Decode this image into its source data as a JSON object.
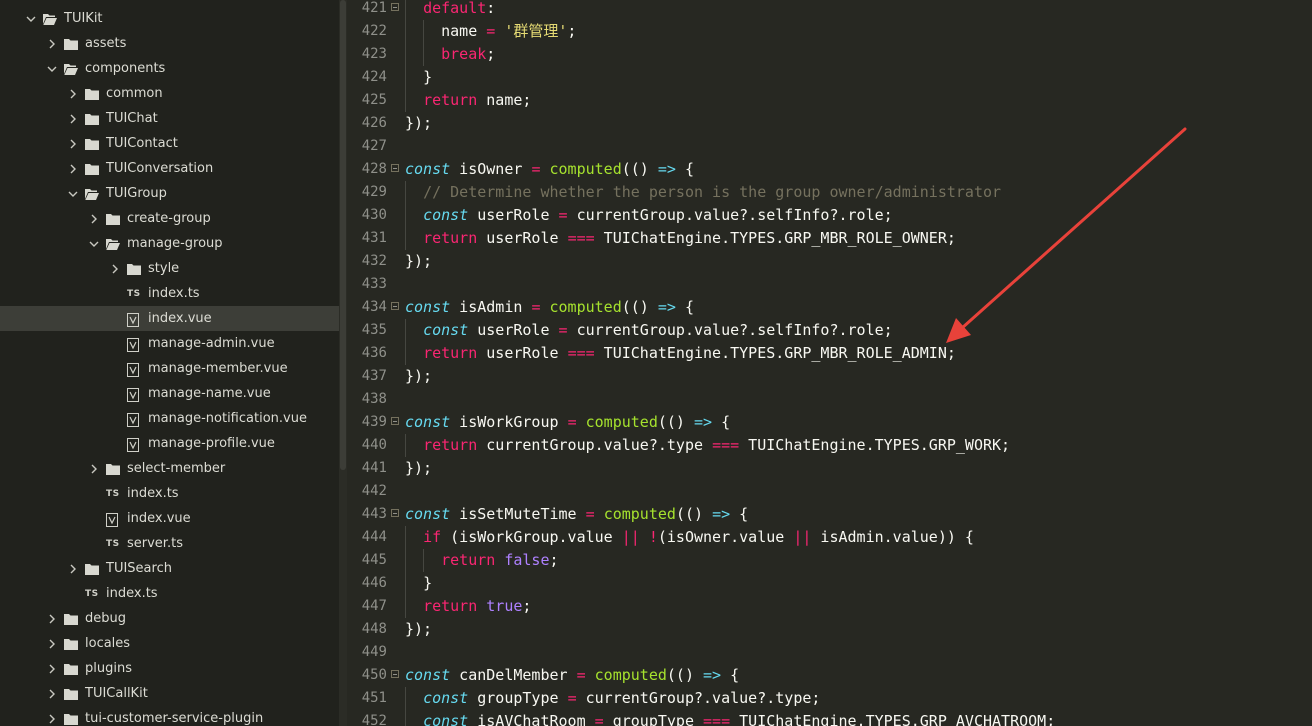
{
  "sidebar": {
    "items": [
      {
        "label": "TUIKit",
        "type": "folder",
        "depth": 0,
        "expanded": true
      },
      {
        "label": "assets",
        "type": "folder",
        "depth": 1,
        "expanded": false
      },
      {
        "label": "components",
        "type": "folder",
        "depth": 1,
        "expanded": true
      },
      {
        "label": "common",
        "type": "folder",
        "depth": 2,
        "expanded": false
      },
      {
        "label": "TUIChat",
        "type": "folder",
        "depth": 2,
        "expanded": false
      },
      {
        "label": "TUIContact",
        "type": "folder",
        "depth": 2,
        "expanded": false
      },
      {
        "label": "TUIConversation",
        "type": "folder",
        "depth": 2,
        "expanded": false
      },
      {
        "label": "TUIGroup",
        "type": "folder",
        "depth": 2,
        "expanded": true
      },
      {
        "label": "create-group",
        "type": "folder",
        "depth": 3,
        "expanded": false
      },
      {
        "label": "manage-group",
        "type": "folder",
        "depth": 3,
        "expanded": true
      },
      {
        "label": "style",
        "type": "folder",
        "depth": 4,
        "expanded": false
      },
      {
        "label": "index.ts",
        "type": "ts",
        "depth": 4,
        "icon_text": "TS"
      },
      {
        "label": "index.vue",
        "type": "vue",
        "depth": 4,
        "selected": true
      },
      {
        "label": "manage-admin.vue",
        "type": "vue",
        "depth": 4
      },
      {
        "label": "manage-member.vue",
        "type": "vue",
        "depth": 4
      },
      {
        "label": "manage-name.vue",
        "type": "vue",
        "depth": 4
      },
      {
        "label": "manage-notification.vue",
        "type": "vue",
        "depth": 4
      },
      {
        "label": "manage-profile.vue",
        "type": "vue",
        "depth": 4
      },
      {
        "label": "select-member",
        "type": "folder",
        "depth": 3,
        "expanded": false
      },
      {
        "label": "index.ts",
        "type": "ts",
        "depth": 3,
        "icon_text": "TS"
      },
      {
        "label": "index.vue",
        "type": "vue",
        "depth": 3
      },
      {
        "label": "server.ts",
        "type": "ts",
        "depth": 3,
        "icon_text": "TS"
      },
      {
        "label": "TUISearch",
        "type": "folder",
        "depth": 2,
        "expanded": false
      },
      {
        "label": "index.ts",
        "type": "ts",
        "depth": 2,
        "icon_text": "TS"
      },
      {
        "label": "debug",
        "type": "folder",
        "depth": 1,
        "expanded": false
      },
      {
        "label": "locales",
        "type": "folder",
        "depth": 1,
        "expanded": false
      },
      {
        "label": "plugins",
        "type": "folder",
        "depth": 1,
        "expanded": false
      },
      {
        "label": "TUICallKit",
        "type": "folder",
        "depth": 1,
        "expanded": false
      },
      {
        "label": "tui-customer-service-plugin",
        "type": "folder",
        "depth": 1,
        "expanded": false
      }
    ]
  },
  "editor": {
    "lines": [
      {
        "n": "421",
        "fold": true,
        "indent": 1,
        "tokens": [
          [
            "kw",
            "default"
          ],
          [
            "p",
            ":"
          ]
        ]
      },
      {
        "n": "422",
        "indent": 2,
        "tokens": [
          [
            "p",
            "name "
          ],
          [
            "op",
            "="
          ],
          [
            "p",
            " "
          ],
          [
            "str",
            "'群管理'"
          ],
          [
            "p",
            ";"
          ]
        ]
      },
      {
        "n": "423",
        "indent": 2,
        "tokens": [
          [
            "kw",
            "break"
          ],
          [
            "p",
            ";"
          ]
        ]
      },
      {
        "n": "424",
        "indent": 1,
        "tokens": [
          [
            "p",
            "}"
          ]
        ]
      },
      {
        "n": "425",
        "indent": 1,
        "tokens": [
          [
            "kw",
            "return"
          ],
          [
            "p",
            " name;"
          ]
        ]
      },
      {
        "n": "426",
        "indent": 0,
        "tokens": [
          [
            "p",
            "});"
          ]
        ]
      },
      {
        "n": "427",
        "indent": 0,
        "tokens": []
      },
      {
        "n": "428",
        "fold": true,
        "indent": 0,
        "tokens": [
          [
            "k",
            "const"
          ],
          [
            "p",
            " isOwner "
          ],
          [
            "op",
            "="
          ],
          [
            "p",
            " "
          ],
          [
            "fn",
            "computed"
          ],
          [
            "p",
            "(() "
          ],
          [
            "k",
            "=>"
          ],
          [
            "p",
            " {"
          ]
        ]
      },
      {
        "n": "429",
        "indent": 1,
        "tokens": [
          [
            "cm",
            "// Determine whether the person is the group owner/administrator"
          ]
        ]
      },
      {
        "n": "430",
        "indent": 1,
        "tokens": [
          [
            "k",
            "const"
          ],
          [
            "p",
            " userRole "
          ],
          [
            "op",
            "="
          ],
          [
            "p",
            " currentGroup.value?.selfInfo?.role;"
          ]
        ]
      },
      {
        "n": "431",
        "indent": 1,
        "tokens": [
          [
            "kw",
            "return"
          ],
          [
            "p",
            " userRole "
          ],
          [
            "op",
            "==="
          ],
          [
            "p",
            " TUIChatEngine.TYPES.GRP_MBR_ROLE_OWNER;"
          ]
        ]
      },
      {
        "n": "432",
        "indent": 0,
        "tokens": [
          [
            "p",
            "});"
          ]
        ]
      },
      {
        "n": "433",
        "indent": 0,
        "tokens": []
      },
      {
        "n": "434",
        "fold": true,
        "indent": 0,
        "tokens": [
          [
            "k",
            "const"
          ],
          [
            "p",
            " isAdmin "
          ],
          [
            "op",
            "="
          ],
          [
            "p",
            " "
          ],
          [
            "fn",
            "computed"
          ],
          [
            "p",
            "(() "
          ],
          [
            "k",
            "=>"
          ],
          [
            "p",
            " {"
          ]
        ]
      },
      {
        "n": "435",
        "indent": 1,
        "tokens": [
          [
            "k",
            "const"
          ],
          [
            "p",
            " userRole "
          ],
          [
            "op",
            "="
          ],
          [
            "p",
            " currentGroup.value?.selfInfo?.role;"
          ]
        ]
      },
      {
        "n": "436",
        "indent": 1,
        "tokens": [
          [
            "kw",
            "return"
          ],
          [
            "p",
            " userRole "
          ],
          [
            "op",
            "==="
          ],
          [
            "p",
            " TUIChatEngine.TYPES.GRP_MBR_ROLE_ADMIN;"
          ]
        ]
      },
      {
        "n": "437",
        "indent": 0,
        "tokens": [
          [
            "p",
            "});"
          ]
        ]
      },
      {
        "n": "438",
        "indent": 0,
        "tokens": []
      },
      {
        "n": "439",
        "fold": true,
        "indent": 0,
        "tokens": [
          [
            "k",
            "const"
          ],
          [
            "p",
            " isWorkGroup "
          ],
          [
            "op",
            "="
          ],
          [
            "p",
            " "
          ],
          [
            "fn",
            "computed"
          ],
          [
            "p",
            "(() "
          ],
          [
            "k",
            "=>"
          ],
          [
            "p",
            " {"
          ]
        ]
      },
      {
        "n": "440",
        "indent": 1,
        "tokens": [
          [
            "kw",
            "return"
          ],
          [
            "p",
            " currentGroup.value?.type "
          ],
          [
            "op",
            "==="
          ],
          [
            "p",
            " TUIChatEngine.TYPES.GRP_WORK;"
          ]
        ]
      },
      {
        "n": "441",
        "indent": 0,
        "tokens": [
          [
            "p",
            "});"
          ]
        ]
      },
      {
        "n": "442",
        "indent": 0,
        "tokens": []
      },
      {
        "n": "443",
        "fold": true,
        "indent": 0,
        "tokens": [
          [
            "k",
            "const"
          ],
          [
            "p",
            " isSetMuteTime "
          ],
          [
            "op",
            "="
          ],
          [
            "p",
            " "
          ],
          [
            "fn",
            "computed"
          ],
          [
            "p",
            "(() "
          ],
          [
            "k",
            "=>"
          ],
          [
            "p",
            " {"
          ]
        ]
      },
      {
        "n": "444",
        "indent": 1,
        "tokens": [
          [
            "kw",
            "if"
          ],
          [
            "p",
            " (isWorkGroup.value "
          ],
          [
            "op",
            "||"
          ],
          [
            "p",
            " "
          ],
          [
            "op",
            "!"
          ],
          [
            "p",
            "(isOwner.value "
          ],
          [
            "op",
            "||"
          ],
          [
            "p",
            " isAdmin.value)) {"
          ]
        ]
      },
      {
        "n": "445",
        "indent": 2,
        "tokens": [
          [
            "kw",
            "return"
          ],
          [
            "p",
            " "
          ],
          [
            "num",
            "false"
          ],
          [
            "p",
            ";"
          ]
        ]
      },
      {
        "n": "446",
        "indent": 1,
        "tokens": [
          [
            "p",
            "}"
          ]
        ]
      },
      {
        "n": "447",
        "indent": 1,
        "tokens": [
          [
            "kw",
            "return"
          ],
          [
            "p",
            " "
          ],
          [
            "num",
            "true"
          ],
          [
            "p",
            ";"
          ]
        ]
      },
      {
        "n": "448",
        "indent": 0,
        "tokens": [
          [
            "p",
            "});"
          ]
        ]
      },
      {
        "n": "449",
        "indent": 0,
        "tokens": []
      },
      {
        "n": "450",
        "fold": true,
        "indent": 0,
        "tokens": [
          [
            "k",
            "const"
          ],
          [
            "p",
            " canDelMember "
          ],
          [
            "op",
            "="
          ],
          [
            "p",
            " "
          ],
          [
            "fn",
            "computed"
          ],
          [
            "p",
            "(() "
          ],
          [
            "k",
            "=>"
          ],
          [
            "p",
            " {"
          ]
        ]
      },
      {
        "n": "451",
        "indent": 1,
        "tokens": [
          [
            "k",
            "const"
          ],
          [
            "p",
            " groupType "
          ],
          [
            "op",
            "="
          ],
          [
            "p",
            " currentGroup?.value?.type;"
          ]
        ]
      },
      {
        "n": "452",
        "indent": 1,
        "tokens": [
          [
            "k",
            "const"
          ],
          [
            "p",
            " isAVChatRoom "
          ],
          [
            "op",
            "="
          ],
          [
            "p",
            " groupType "
          ],
          [
            "op",
            "==="
          ],
          [
            "p",
            " TUIChatEngine.TYPES.GRP_AVCHATROOM;"
          ]
        ]
      }
    ]
  },
  "colors": {
    "annotation_arrow": "#e8423a"
  }
}
